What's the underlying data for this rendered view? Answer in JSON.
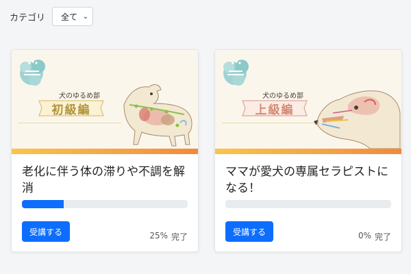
{
  "filter": {
    "label": "カテゴリ",
    "selected": "全て"
  },
  "colors": {
    "accent": "#0d6efd",
    "stripe": [
      "#f8c54a",
      "#f08a3c"
    ]
  },
  "courses": [
    {
      "series": "犬のゆるめ部",
      "level": "初級編",
      "title": "老化に伴う体の滞りや不調を解消",
      "progress": 0.25,
      "button": "受講する",
      "percent": "25%",
      "done": "完了"
    },
    {
      "series": "犬のゆるめ部",
      "level": "上級編",
      "title": "ママが愛犬の専属セラピストになる！",
      "progress": 0,
      "button": "受講する",
      "percent": "0%",
      "done": "完了"
    }
  ]
}
